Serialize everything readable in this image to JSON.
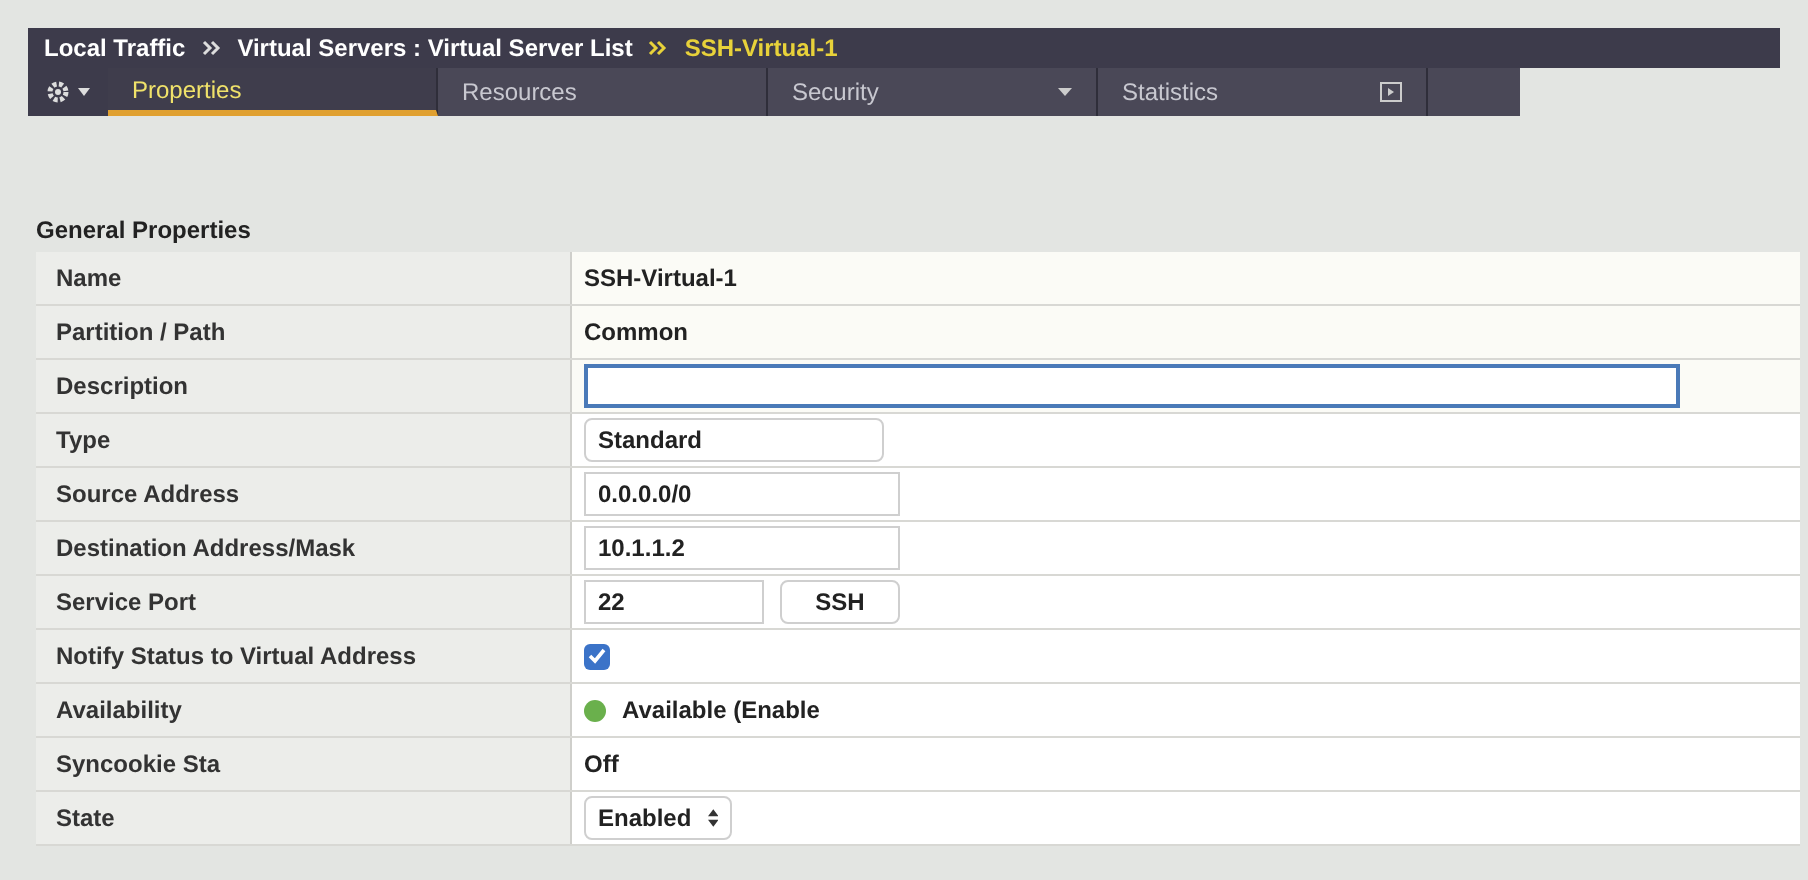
{
  "breadcrumb": [
    {
      "label": "Local Traffic",
      "current": false
    },
    {
      "label": "Virtual Servers : Virtual Server List",
      "current": false
    },
    {
      "label": "SSH-Virtual-1",
      "current": true
    }
  ],
  "tabs": [
    {
      "label": "Properties",
      "selected": true,
      "kind": "plain"
    },
    {
      "label": "Resources",
      "selected": false,
      "kind": "plain"
    },
    {
      "label": "Security",
      "selected": false,
      "kind": "menu"
    },
    {
      "label": "Statistics",
      "selected": false,
      "kind": "popout"
    }
  ],
  "section_title": "General Properties",
  "properties": [
    {
      "label": "Name",
      "kind": "text",
      "value": "SSH-Virtual-1"
    },
    {
      "label": "Partition / Path",
      "kind": "text",
      "value": "Common"
    },
    {
      "label": "Description",
      "kind": "wide_input"
    },
    {
      "label": "Type",
      "kind": "select",
      "value": "Standard"
    },
    {
      "label": "Source Address",
      "kind": "input",
      "value": "0.0.0.0/0"
    },
    {
      "label": "Destination Address/Mask",
      "kind": "input",
      "value": "10.1.1.2"
    },
    {
      "label": "Service Port",
      "kind": "port",
      "value": "22",
      "service": "SSH"
    },
    {
      "label": "Notify Status to Virtual Address",
      "kind": "checkbox",
      "checked": true
    },
    {
      "label": "Availability",
      "kind": "status",
      "value": "Available (Enable",
      "color": "#6ab04c"
    },
    {
      "label": "Syncookie Sta",
      "kind": "text",
      "value": "Off"
    },
    {
      "label": "State",
      "kind": "dropdown",
      "value": "Enabled"
    }
  ]
}
